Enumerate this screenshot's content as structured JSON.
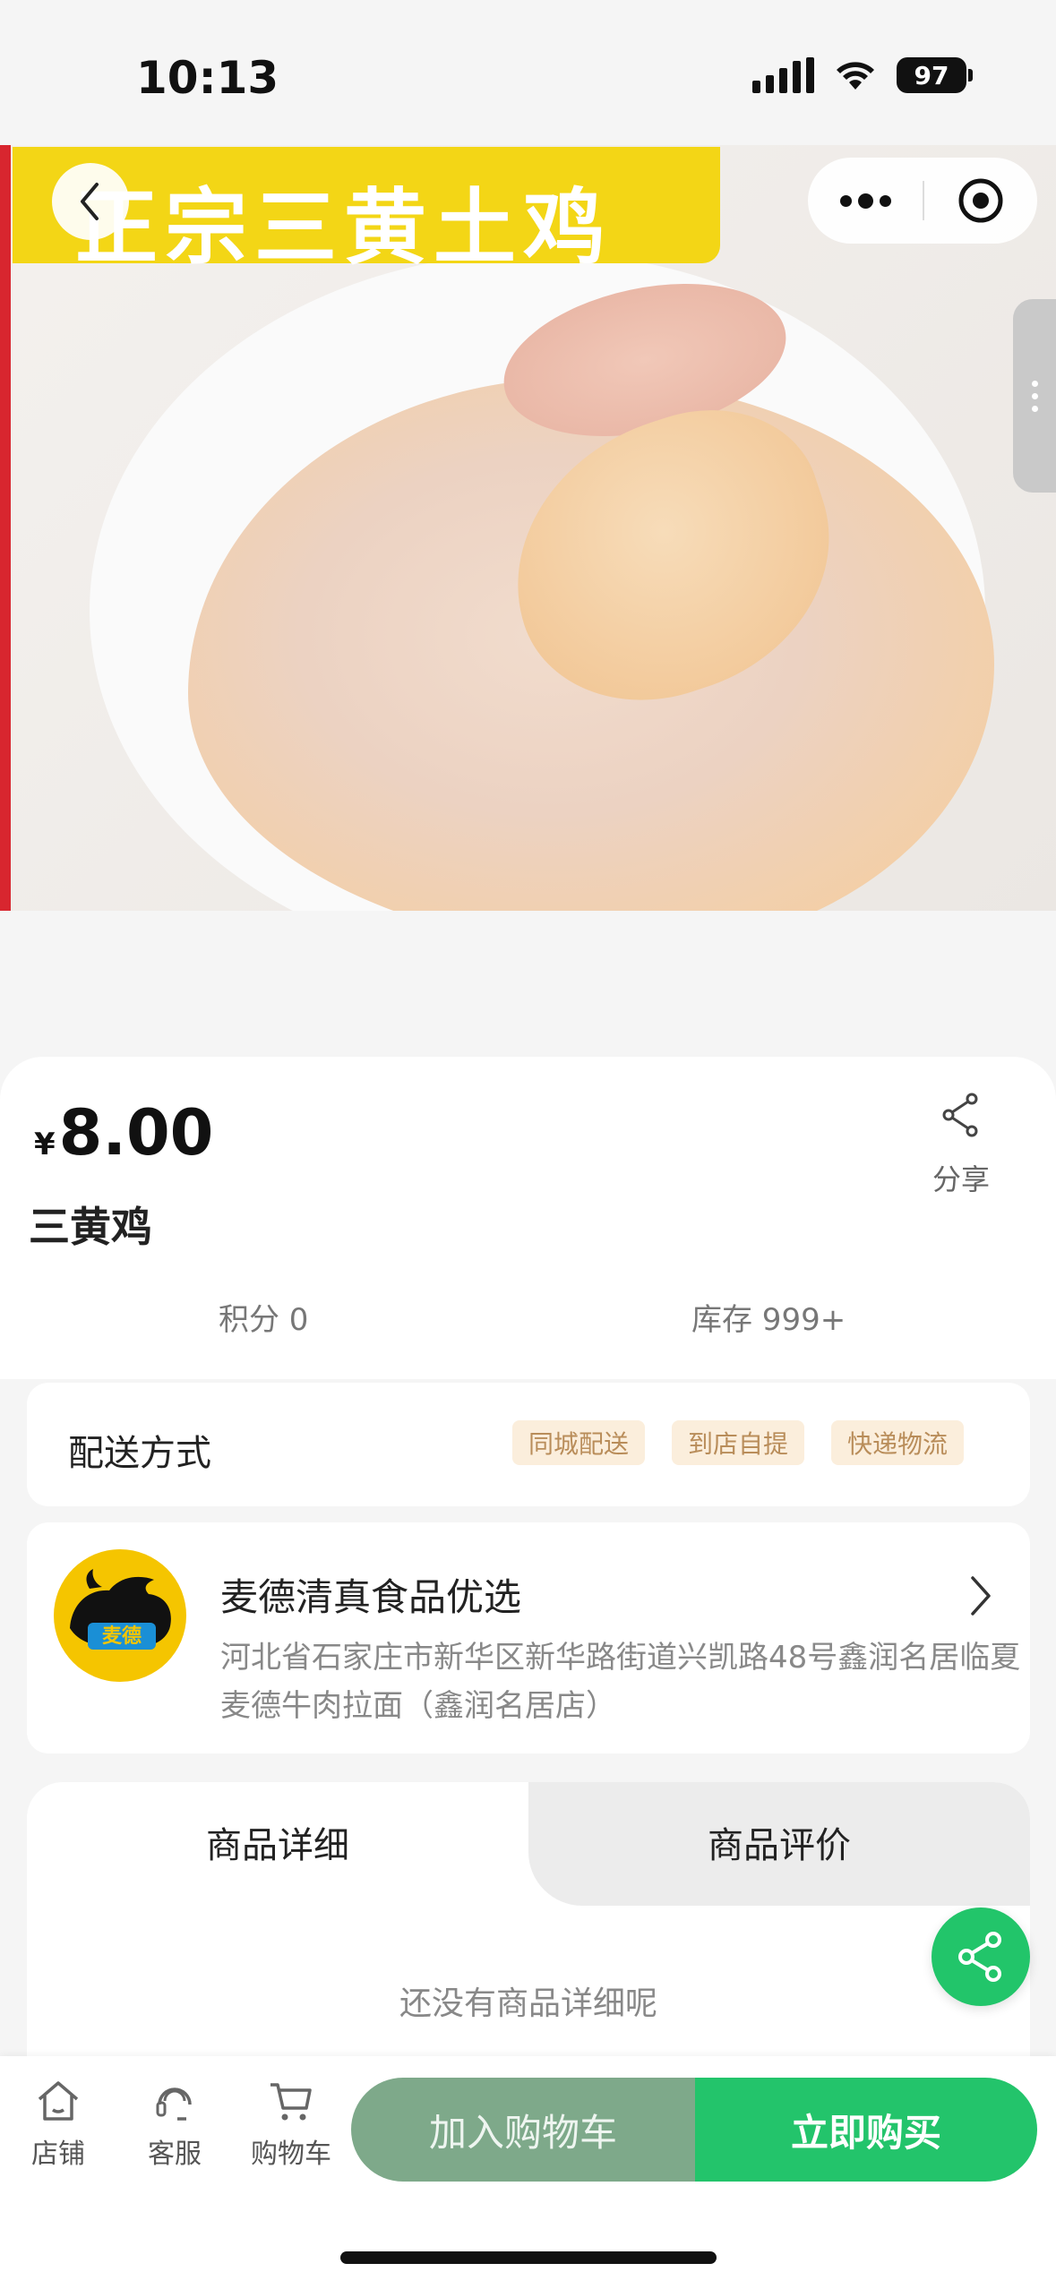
{
  "status_bar": {
    "time": "10:13",
    "battery": "97",
    "icons": [
      "signal-icon",
      "wifi-icon",
      "battery-icon"
    ]
  },
  "product_image": {
    "banner_text": "正宗三黄土鸡"
  },
  "nav": {
    "back_icon": "chevron-left-icon",
    "menu_icon": "more-dots-icon",
    "target_icon": "target-icon"
  },
  "product": {
    "price_symbol": "¥",
    "price": "8.00",
    "name": "三黄鸡",
    "share_label": "分享",
    "points": "积分 0",
    "stock": "库存 999+"
  },
  "delivery": {
    "label": "配送方式",
    "options": [
      "同城配送",
      "到店自提",
      "快递物流"
    ]
  },
  "store": {
    "name": "麦德清真食品优选",
    "address": "河北省石家庄市新华区新华路街道兴凯路48号鑫润名居临夏麦德牛肉拉面（鑫润名居店）",
    "logo_text": "麦德"
  },
  "tabs": {
    "detail": "商品详细",
    "review": "商品评价",
    "empty_text": "还没有商品详细呢"
  },
  "bottom_bar": {
    "store": "店铺",
    "service": "客服",
    "cart": "购物车",
    "add_cart": "加入购物车",
    "buy_now": "立即购买"
  },
  "colors": {
    "accent_green": "#23c46b",
    "muted_green": "#7ea98a",
    "tag_bg": "#fbeedc",
    "tag_text": "#b98d5a"
  }
}
